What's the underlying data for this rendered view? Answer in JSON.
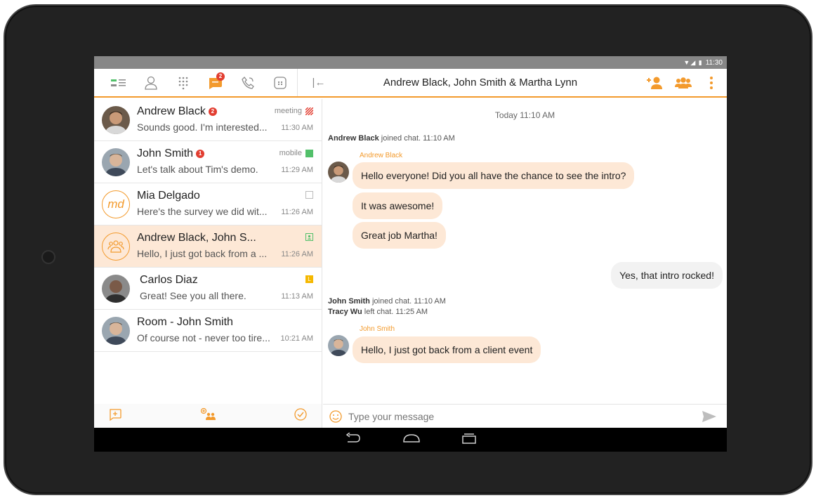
{
  "statusbar": {
    "time": "11:30"
  },
  "toolbar": {
    "chat_badge": "2",
    "chat_title": "Andrew Black, John Smith & Martha Lynn",
    "collapse_glyph": "|←"
  },
  "colors": {
    "accent": "#f39a2c",
    "active_row": "#fde8d6",
    "badge": "#e23d30",
    "mobile_status": "#52c06a",
    "yellow_status": "#f5b800"
  },
  "conversations": [
    {
      "name": "Andrew Black",
      "badge": "2",
      "status": "meeting",
      "preview": "Sounds good. I'm interested...",
      "time": "11:30 AM"
    },
    {
      "name": "John Smith",
      "badge": "1",
      "status": "mobile",
      "preview": "Let's talk about Tim's demo.",
      "time": "11:29 AM"
    },
    {
      "name": "Mia Delgado",
      "initials": "md",
      "preview": "Here's the survey we did wit...",
      "time": "11:26 AM"
    },
    {
      "name": "Andrew Black, John S...",
      "preview": "Hello, I just got back from a ...",
      "time": "11:26 AM"
    },
    {
      "name": "Carlos Diaz",
      "status_letter": "L",
      "preview": "Great! See you all there.",
      "time": "11:13 AM"
    },
    {
      "name": "Room - John Smith",
      "preview": "Of course not - never too tire...",
      "time": "10:21 AM"
    }
  ],
  "chat": {
    "day": "Today 11:10 AM",
    "sys1_name": "Andrew Black",
    "sys1_text": " joined chat. 11:10 AM",
    "sender1": "Andrew Black",
    "m1": "Hello everyone! Did you all have the chance to see the intro?",
    "m2": "It was awesome!",
    "m3": "Great job Martha!",
    "m4": "Yes, that intro rocked!",
    "sys2_name": "John Smith",
    "sys2_text": " joined chat. 11:10 AM",
    "sys3_name": "Tracy Wu",
    "sys3_text": " left chat. 11:25 AM",
    "sender2": "John Smith",
    "m5": "Hello, I just got back from a client event"
  },
  "composer": {
    "placeholder": "Type your message"
  }
}
